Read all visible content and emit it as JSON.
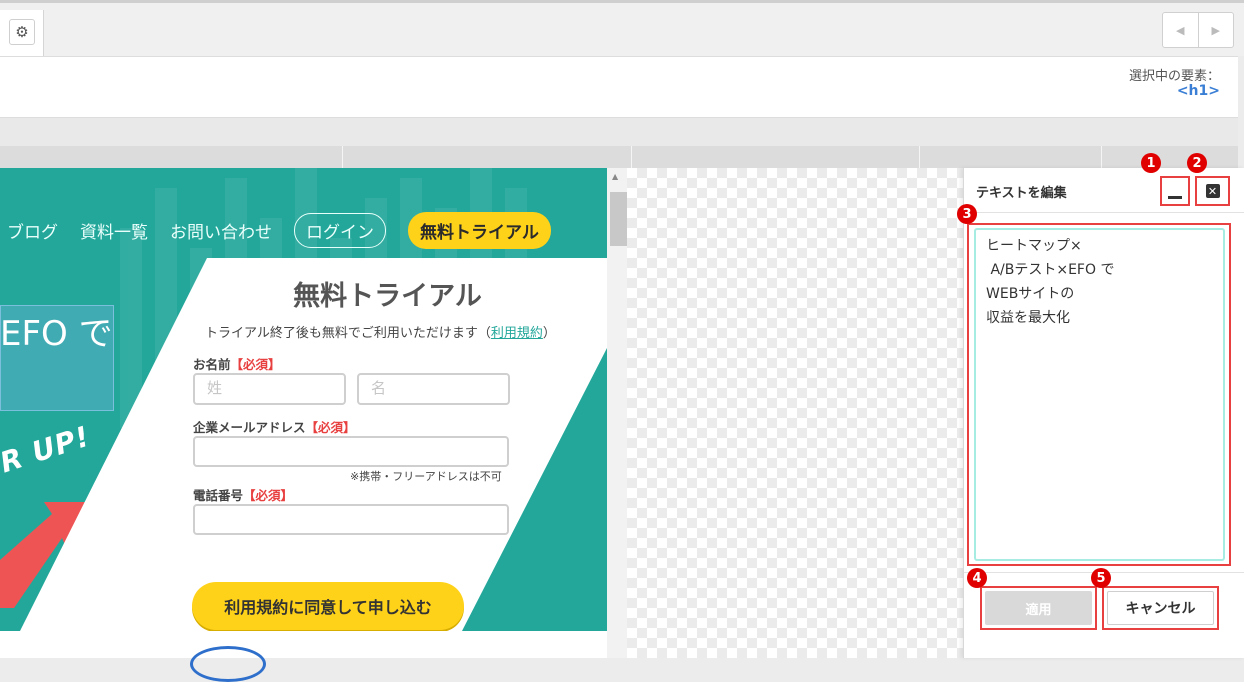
{
  "toolbar": {
    "settings_icon": "gear-icon",
    "prev_icon": "chevron-left-icon",
    "next_icon": "chevron-right-icon"
  },
  "info": {
    "selected_label": "選択中の要素：",
    "selected_value": "<h1>"
  },
  "preview": {
    "nav": {
      "blog": "ブログ",
      "docs": "資料一覧",
      "contact": "お問い合わせ",
      "login": "ログイン",
      "trial": "無料トライアル"
    },
    "hero_text": "EFO で",
    "powerup_text": "R UP!",
    "form": {
      "title": "無料トライアル",
      "subtitle": "トライアル終了後も無料でご利用いただけます（",
      "subtitle_link": "利用規約",
      "subtitle_end": "）",
      "name_label": "お名前",
      "required": "【必須】",
      "last_name_placeholder": "姓",
      "first_name_placeholder": "名",
      "email_label": "企業メールアドレス",
      "email_note": "※携帯・フリーアドレスは不可",
      "phone_label": "電話番号",
      "submit": "利用規約に同意して申し込む"
    }
  },
  "panel": {
    "title": "テキストを編集",
    "text": "ヒートマップ×\n A/Bテスト×EFO で\nWEBサイトの\n収益を最大化",
    "apply": "適用",
    "cancel": "キャンセル",
    "badges": [
      "1",
      "2",
      "3",
      "4",
      "5"
    ]
  },
  "colors": {
    "accent_teal": "#23a79a",
    "trial_yellow": "#ffd21a",
    "highlight_red": "#e84040",
    "link_blue": "#3a7fd5"
  }
}
